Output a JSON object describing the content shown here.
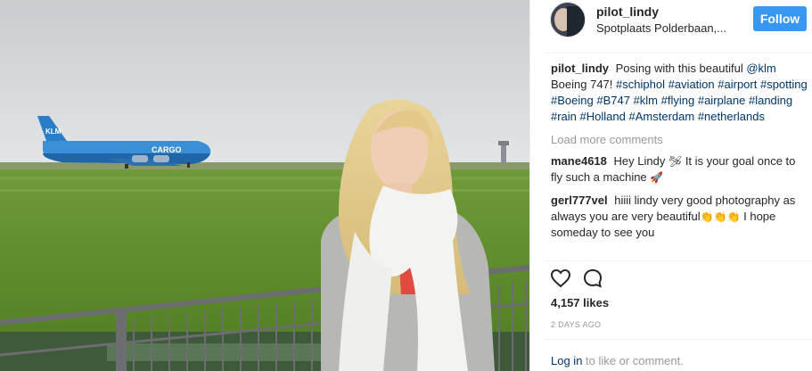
{
  "header": {
    "username": "pilot_lindy",
    "location": "Spotplaats Polderbaan,...",
    "follow_label": "Follow"
  },
  "caption": {
    "author": "pilot_lindy",
    "text": "Posing with this beautiful",
    "tags": [
      "@klm",
      "Boeing 747!",
      "#schiphol",
      "#aviation",
      "#airport",
      "#spotting",
      "#Boeing",
      "#B747",
      "#klm",
      "#flying",
      "#airplane",
      "#landing",
      "#rain",
      "#Holland",
      "#Amsterdam",
      "#netherlands"
    ]
  },
  "load_more_label": "Load more comments",
  "comments": [
    {
      "author": "mane4618",
      "text_a": "Hey Lindy",
      "emoji_a": "🛩",
      "text_b": "It is your goal once to fly such a machine",
      "emoji_b": "🚀"
    },
    {
      "author": "gerl777vel",
      "text_a": "hiiii lindy very good photography as always you are very beautiful",
      "emoji_a": "👏👏👏",
      "text_b": "I hope someday to see you"
    }
  ],
  "likes": "4,157 likes",
  "date": "2 DAYS AGO",
  "footer": {
    "login_link": "Log in",
    "rest": "to like or comment."
  },
  "photo": {
    "airline_logo": "KLM",
    "fuselage_text": "CARGO"
  },
  "icons": {
    "like": "heart-icon",
    "comment": "comment-bubble-icon"
  },
  "colors": {
    "accent": "#3897f0",
    "link": "#003569",
    "muted": "#999999",
    "klm_blue": "#2a7ec8"
  }
}
